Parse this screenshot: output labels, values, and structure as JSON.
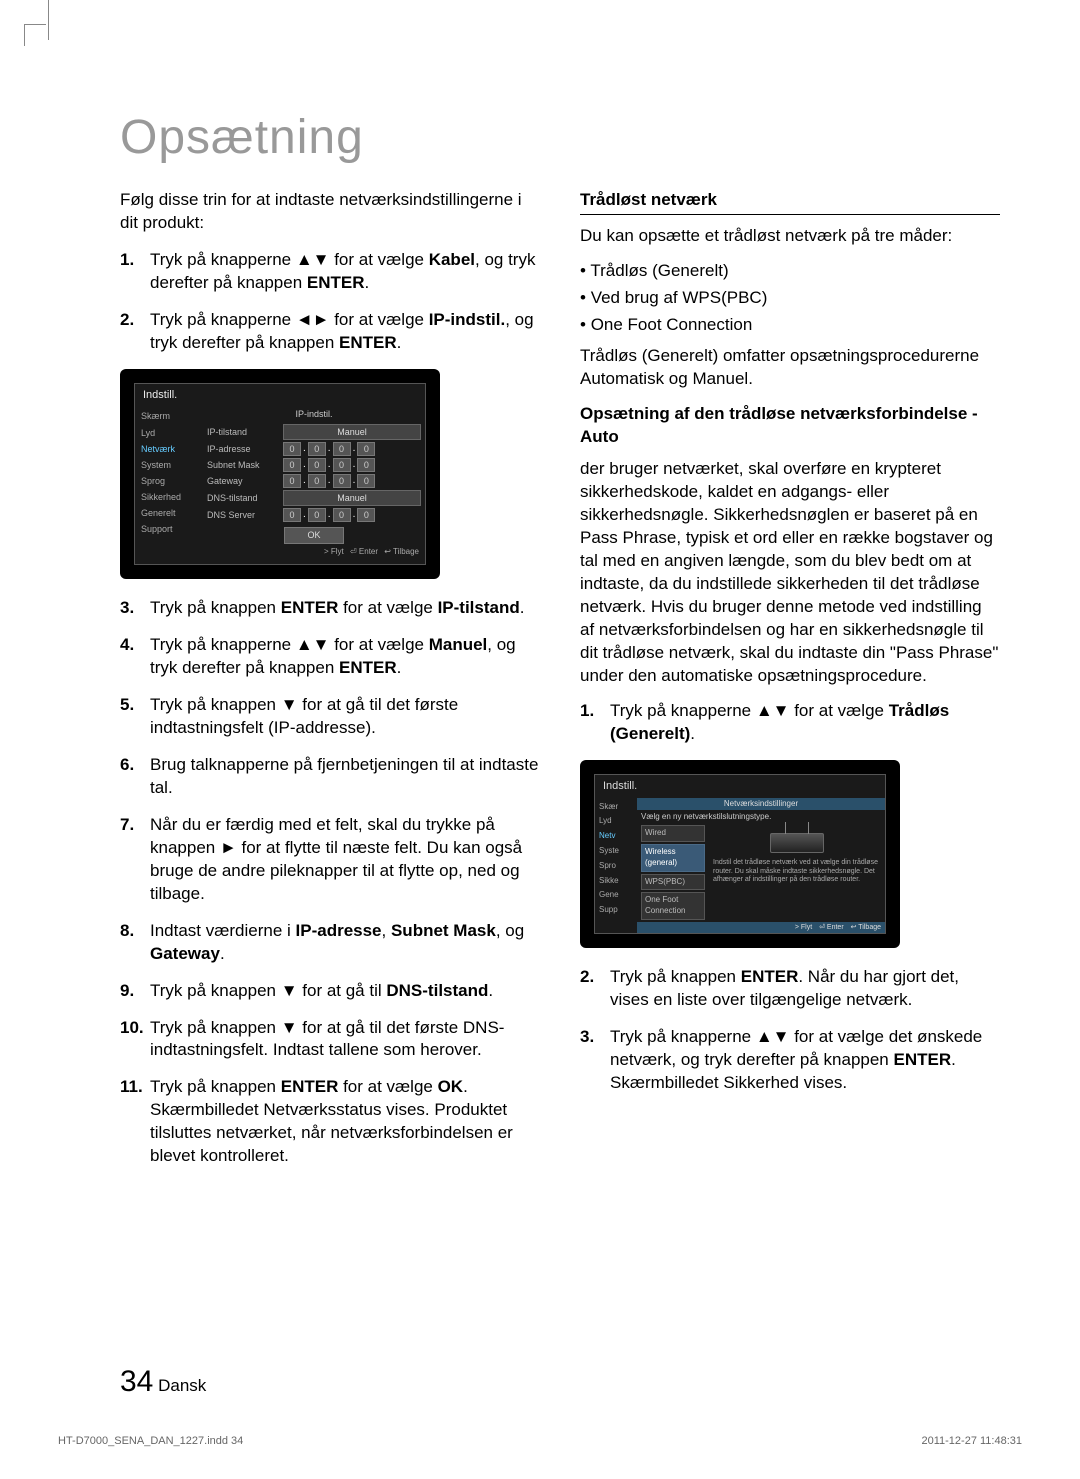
{
  "title": "Opsætning",
  "left": {
    "intro": "Følg disse trin for at indtaste netværksindstillingerne i dit produkt:",
    "steps": [
      {
        "pre": "Tryk på knapperne ▲▼ for at vælge ",
        "b1": "Kabel",
        "mid": ", og tryk derefter på knappen ",
        "b2": "ENTER",
        "post": "."
      },
      {
        "pre": "Tryk på knapperne ◄► for at vælge ",
        "b1": "IP-indstil.",
        "mid": ", og tryk derefter på knappen ",
        "b2": "ENTER",
        "post": "."
      }
    ],
    "steps2": [
      {
        "pre": "Tryk på knappen ",
        "b1": "ENTER",
        "mid": " for at vælge ",
        "b2": "IP-tilstand",
        "post": "."
      },
      {
        "pre": "Tryk på knapperne ▲▼ for at vælge ",
        "b1": "Manuel",
        "mid": ", og tryk derefter på knappen ",
        "b2": "ENTER",
        "post": "."
      },
      {
        "pre": "Tryk på knappen ▼ for at gå til det første indtastningsfelt (IP-addresse).",
        "b1": "",
        "mid": "",
        "b2": "",
        "post": ""
      },
      {
        "pre": "Brug talknapperne på fjernbetjeningen til at indtaste tal.",
        "b1": "",
        "mid": "",
        "b2": "",
        "post": ""
      },
      {
        "pre": "Når du er færdig med et felt, skal du trykke på knappen ► for at flytte til næste felt. Du kan også bruge de andre pileknapper til at flytte op, ned og tilbage.",
        "b1": "",
        "mid": "",
        "b2": "",
        "post": ""
      },
      {
        "pre": "Indtast værdierne i ",
        "b1": "IP-adresse",
        "mid": ", ",
        "b2": "Subnet Mask",
        "post2": ", og ",
        "b3": "Gateway",
        "post": "."
      },
      {
        "pre": "Tryk på knappen ▼ for at gå til ",
        "b1": "DNS-tilstand",
        "mid": "",
        "b2": "",
        "post": "."
      },
      {
        "pre": "Tryk på knappen ▼ for at gå til det første DNS-indtastningsfelt. Indtast tallene som herover.",
        "b1": "",
        "mid": "",
        "b2": "",
        "post": ""
      },
      {
        "pre": "Tryk på knappen ",
        "b1": "ENTER",
        "mid": " for at vælge ",
        "b2": "OK",
        "post": ". Skærmbilledet Netværksstatus vises. Produktet tilsluttes netværket, når netværksforbindelsen er blevet kontrolleret."
      }
    ],
    "tv": {
      "title": "Indstill.",
      "panel": "IP-indstil.",
      "side": [
        "Skærm",
        "Lyd",
        "Netværk",
        "System",
        "Sprog",
        "Sikkerhed",
        "Generelt",
        "Support"
      ],
      "rows": {
        "ip_mode": "IP-tilstand",
        "ip_mode_val": "Manuel",
        "ip_addr": "IP-adresse",
        "subnet": "Subnet Mask",
        "gateway": "Gateway",
        "dns_mode": "DNS-tilstand",
        "dns_mode_val": "Manuel",
        "dns_server": "DNS Server"
      },
      "ok": "OK",
      "foot": {
        "move": "> Flyt",
        "enter": "⏎ Enter",
        "back": "↩ Tilbage"
      }
    }
  },
  "right": {
    "subhead": "Trådløst netværk",
    "intro": "Du kan opsætte et trådløst netværk på tre måder:",
    "bullets": [
      "Trådløs (Generelt)",
      "Ved brug af WPS(PBC)",
      "One Foot Connection"
    ],
    "note": "Trådløs (Generelt) omfatter opsætningsprocedurerne Automatisk og Manuel.",
    "subhead2": "Opsætning af den trådløse netværksforbindelse - Auto",
    "body": "der bruger netværket, skal overføre en krypteret sikkerhedskode, kaldet en adgangs- eller sikkerhedsnøgle. Sikkerhedsnøglen er baseret på en Pass Phrase, typisk et ord eller en række bogstaver og tal med en angiven længde, som du blev bedt om at indtaste, da du indstillede sikkerheden til det trådløse netværk. Hvis du bruger denne metode ved indstilling af netværksforbindelsen og har en sikkerhedsnøgle til dit trådløse netværk, skal du indtaste din \"Pass Phrase\" under den automatiske opsætningsprocedure.",
    "steps": [
      {
        "pre": "Tryk på knapperne ▲▼ for at vælge ",
        "b1": "Trådløs (Generelt)",
        "post": "."
      }
    ],
    "steps2": [
      {
        "pre": "Tryk på knappen ",
        "b1": "ENTER",
        "mid": ". Når du har gjort det, vises en liste over tilgængelige netværk."
      },
      {
        "pre": "Tryk på knapperne ▲▼ for at vælge det ønskede netværk, og tryk derefter på knappen ",
        "b1": "ENTER",
        "mid": ". Skærmbilledet Sikkerhed vises."
      }
    ],
    "tv": {
      "title": "Indstill.",
      "panel": "Netværksindstillinger",
      "sub": "Vælg en ny netværkstilslutningstype.",
      "side": [
        "Skær",
        "Lyd",
        "Netv",
        "Syste",
        "Spro",
        "Sikke",
        "Gene",
        "Supp"
      ],
      "types": [
        "Wired",
        "Wireless (general)",
        "WPS(PBC)",
        "One Foot Connection"
      ],
      "desc": "Indstil det trådløse netværk ved at vælge din trådløse router. Du skal måske indtaste sikkerhedsnøgle. Det afhænger af indstillinger på den trådløse router.",
      "foot": {
        "move": "> Flyt",
        "enter": "⏎ Enter",
        "back": "↩ Tilbage"
      }
    }
  },
  "page": {
    "num": "34",
    "lang": "Dansk"
  },
  "footer": {
    "file": "HT-D7000_SENA_DAN_1227.indd   34",
    "date": "2011-12-27   11:48:31"
  }
}
